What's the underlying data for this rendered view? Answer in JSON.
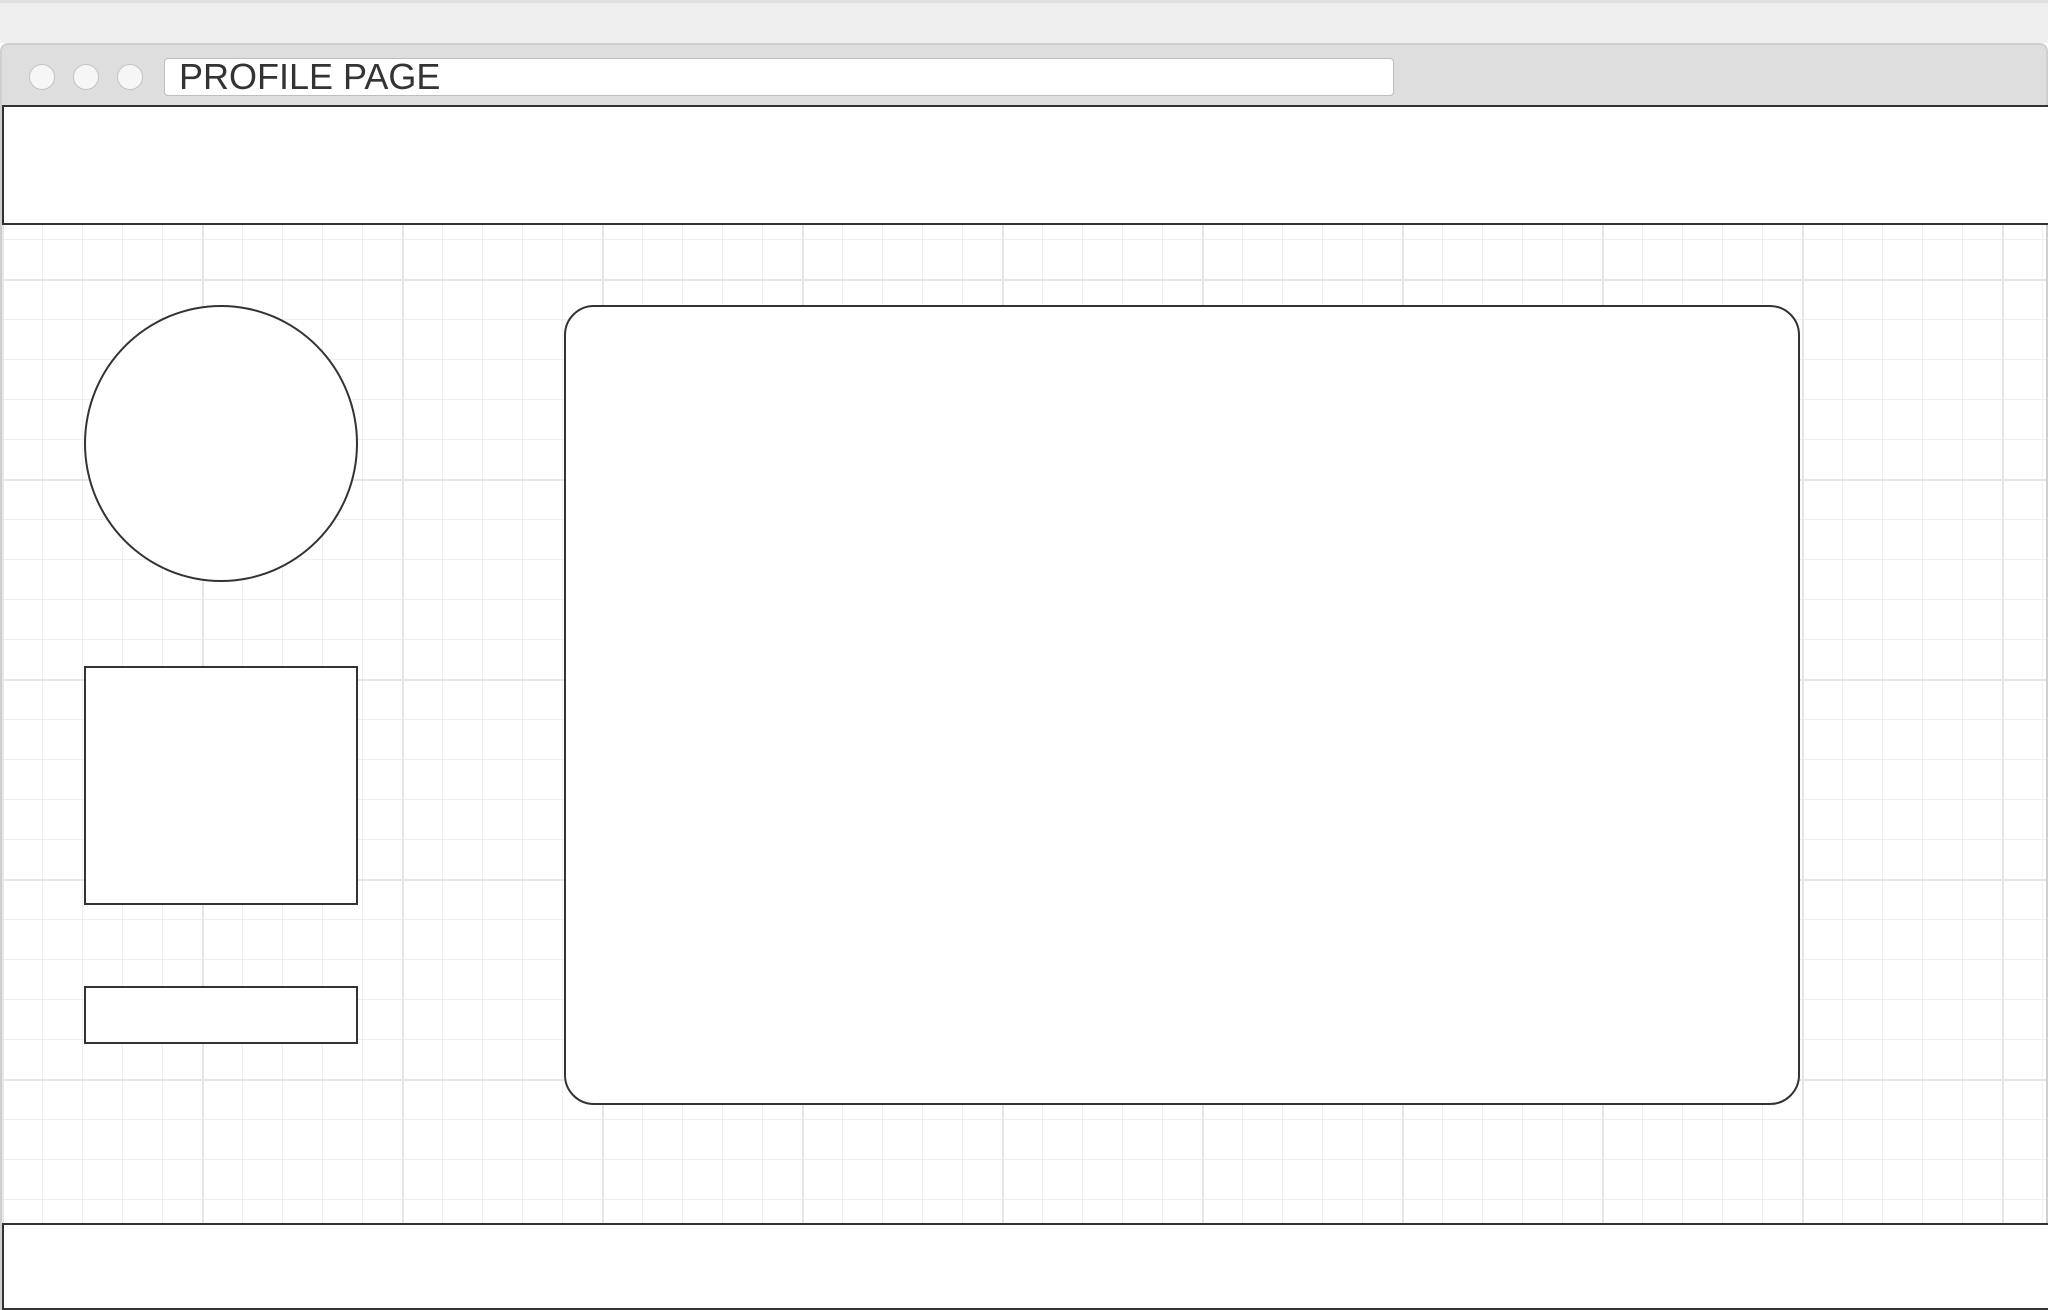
{
  "browser": {
    "address_bar_text": "PROFILE PAGE"
  },
  "colors": {
    "outline": "#333333",
    "chrome": "#dedede",
    "grid_line": "#e6e6e6"
  }
}
